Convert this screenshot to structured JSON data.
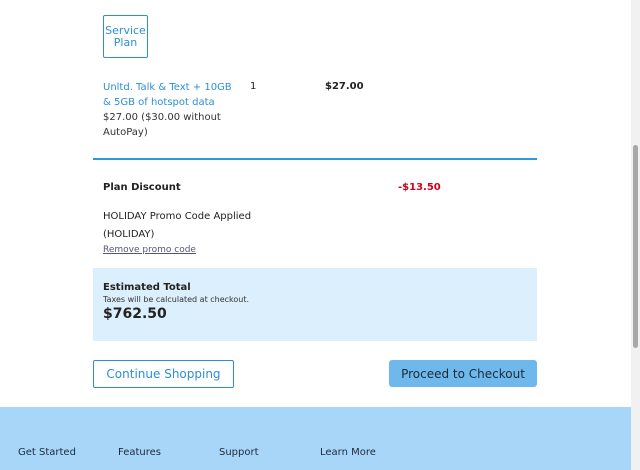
{
  "plan_icon": {
    "line1": "Service",
    "line2": "Plan"
  },
  "cart_item": {
    "name": "Unltd. Talk & Text + 10GB & 5GB of hotspot data",
    "price_note": "$27.00 ($30.00 without AutoPay)",
    "quantity": "1",
    "price": "$27.00"
  },
  "discount": {
    "label": "Plan Discount",
    "amount": "-$13.50",
    "promo_text": "HOLIDAY Promo Code Applied (HOLIDAY)",
    "remove_label": "Remove promo code"
  },
  "total": {
    "label": "Estimated Total",
    "tax_note": "Taxes will be calculated at checkout.",
    "amount": "$762.50"
  },
  "buttons": {
    "continue_label": "Continue Shopping",
    "checkout_label": "Proceed to Checkout"
  },
  "footer": {
    "links": [
      "Get Started",
      "Features",
      "Support",
      "Learn More"
    ]
  },
  "colors": {
    "accent": "#2b8fd6",
    "discount": "#d0021b",
    "total_bg": "#dbeffc",
    "checkout_bg": "#6fb8ec",
    "footer_bg": "#a8d6f8"
  }
}
